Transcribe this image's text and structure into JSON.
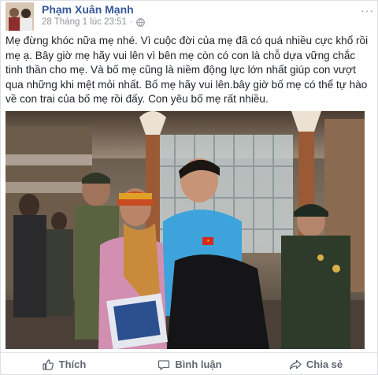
{
  "post": {
    "author": "Phạm Xuân Mạnh",
    "timestamp": "28 Tháng 1 lúc 23:51",
    "privacy_icon": "globe-icon",
    "text": "Mẹ đừng khóc nữa mẹ nhé. Vì cuộc đời của mẹ đã có quá nhiều cực khổ rồi mẹ ạ. Bây giờ mẹ hãy vui lên vì bên mẹ còn có con là chỗ dựa vững chắc tinh thần cho mẹ. Và bố mẹ cũng là niềm động lực lớn nhất giúp con vượt qua những khi mệt mỏi nhất. Bố mẹ hãy vui lên.bây giờ bố mẹ có thể tự hào về con trai của bố mẹ rồi đấy. Con yêu bố mẹ rất nhiều.",
    "more_label": "···"
  },
  "actions": {
    "like_label": "Thích",
    "comment_label": "Bình luận",
    "share_label": "Chia sẻ"
  },
  "colors": {
    "author": "#365899",
    "meta": "#90949c",
    "action": "#606770"
  }
}
